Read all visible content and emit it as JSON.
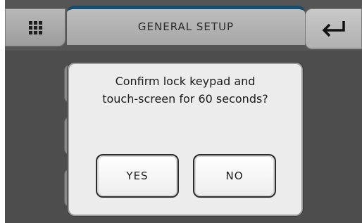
{
  "header": {
    "title": "GENERAL SETUP",
    "menu_icon": "grid-menu-icon",
    "back_icon": "return-arrow-icon"
  },
  "dialog": {
    "message_line1": "Confirm lock keypad and",
    "message_line2": "touch-screen for 60 seconds?",
    "yes_label": "YES",
    "no_label": "NO"
  },
  "colors": {
    "screen_bg": "#4d4d4d",
    "title_accent": "#1b4a6b",
    "dialog_bg": "#ececec"
  }
}
